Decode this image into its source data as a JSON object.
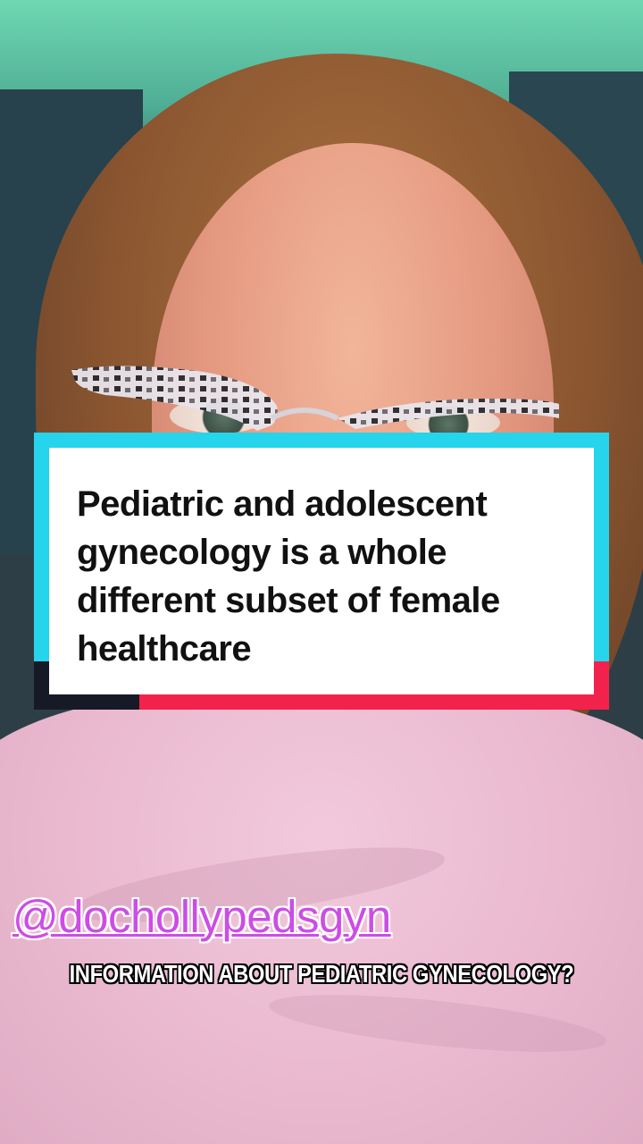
{
  "caption": {
    "text": "Pediatric and adolescent gynecology is a whole different subset of female healthcare"
  },
  "overlay": {
    "mention": "@dochollypedsgyn",
    "subtitle": "INFORMATION ABOUT PEDIATRIC GYNECOLOGY?"
  },
  "colors": {
    "card_cyan": "#26d4ec",
    "card_red": "#f3224c",
    "card_dark": "#161a26",
    "mention": "#cc4de6"
  }
}
